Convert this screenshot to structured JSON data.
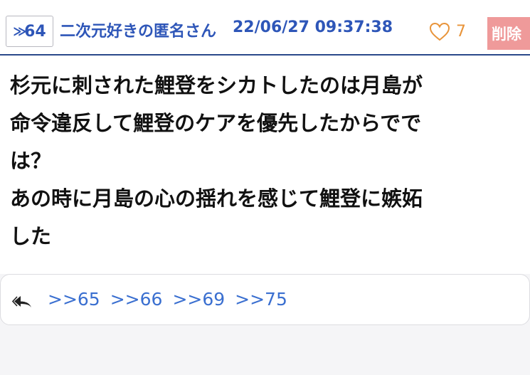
{
  "post": {
    "res_number": "64",
    "author": "二次元好きの匿名さん",
    "timestamp": "22/06/27 09:37:38",
    "like_count": "7",
    "delete_label": "削除",
    "body_lines": [
      "杉元に刺された鯉登をシカトしたのは月島が",
      "命令違反して鯉登のケアを優先したからでで",
      "は？",
      "あの時に月島の心の揺れを感じて鯉登に嫉妬",
      "した"
    ]
  },
  "replies": {
    "links": [
      ">>65",
      ">>66",
      ">>69",
      ">>75"
    ]
  },
  "colors": {
    "header_text": "#2e56b8",
    "like": "#e8943a",
    "delete_bg": "#ef9a9a",
    "link": "#3a6fd0",
    "divider": "#2a4a8a"
  },
  "icons": {
    "res_marker": "double-chevron-right-icon",
    "like": "heart-outline-icon",
    "reply": "reply-icon"
  }
}
